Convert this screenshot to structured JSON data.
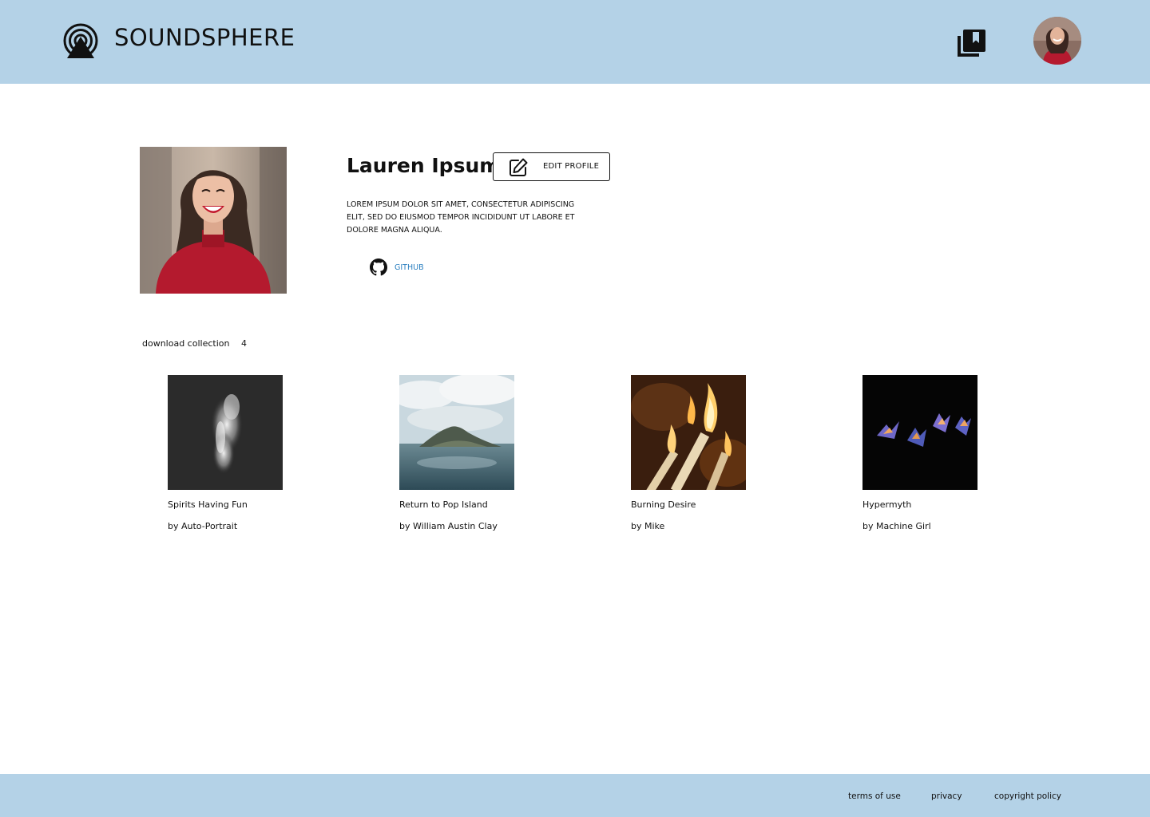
{
  "header": {
    "brand": "SOUNDSPHERE",
    "logo_icon": "radio-broadcast-icon",
    "collections_icon": "library-collection-icon"
  },
  "profile": {
    "name": "Lauren Ipsum",
    "edit_label": "EDIT PROFILE",
    "bio": "LOREM IPSUM DOLOR SIT AMET, CONSECTETUR ADIPISCING ELIT, SED DO EIUSMOD TEMPOR INCIDIDUNT UT LABORE ET DOLORE MAGNA ALIQUA.",
    "github_label": "GITHUB"
  },
  "collection": {
    "label": "download collection",
    "count": "4",
    "albums": [
      {
        "title": "Spirits Having Fun",
        "artist": "by Auto-Portrait"
      },
      {
        "title": "Return to Pop Island",
        "artist": "by William Austin Clay"
      },
      {
        "title": "Burning Desire",
        "artist": "by Mike"
      },
      {
        "title": "Hypermyth",
        "artist": "by Machine Girl"
      }
    ]
  },
  "footer": {
    "links": [
      "terms of use",
      "privacy",
      "copyright policy"
    ]
  },
  "colors": {
    "header_bg": "#b4d2e7",
    "footer_bg": "#b4d2e7",
    "link": "#2a7fc0"
  }
}
